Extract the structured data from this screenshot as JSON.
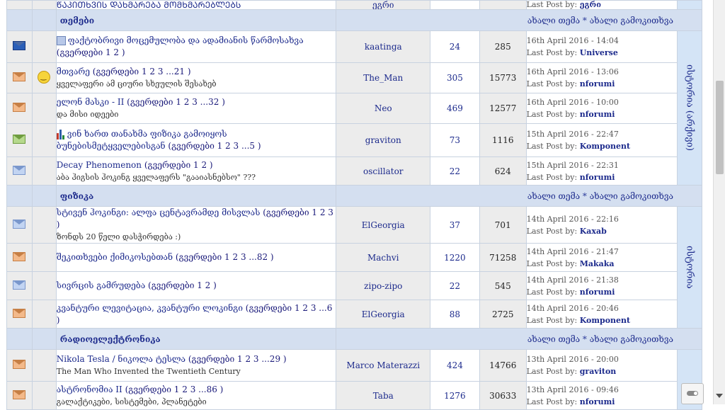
{
  "top_partial": {
    "title": "ᲬᲐᲙᲘᲗᲮᲕᲘᲡ ᲓᲐᲮᲛᲐᲠᲔᲑᲐ ᲛᲝᲛᲮᲛᲐᲠᲔᲑᲚᲔᲑᲡ",
    "author": "ეგრი",
    "last_prefix": "Last Post by:",
    "last_user": "ეგრი"
  },
  "categories": [
    {
      "title": "თემები",
      "new_topic": "ახალი თემა",
      "separator": "*",
      "new_poll": "ახალი გამოკითხვა",
      "side_label": "ისტორია (არქივი)",
      "topics": [
        {
          "icon": "envelope-new",
          "emoticon": "",
          "prefix_icon": "mini",
          "title": "ფაქტობრივი მოცემულობა და ადამიანის წარმოსახვა",
          "pages": "(გვერდები 1 2 )",
          "desc": "",
          "author": "kaatinga",
          "replies": "24",
          "views": "285",
          "last_date": "16th April 2016 - 14:04",
          "last_by": "Last Post by:",
          "last_user": "Universe"
        },
        {
          "icon": "envelope-hot",
          "emoticon": "smiley",
          "prefix_icon": "",
          "title": "მთვარე",
          "pages": "(გვერდები 1 2 3 ...21 )",
          "desc": "ყველაფერი ამ ციური სხეულის შესახებ",
          "author": "The_Man",
          "replies": "305",
          "views": "15773",
          "last_date": "16th April 2016 - 13:06",
          "last_by": "Last Post by:",
          "last_user": "nforumi"
        },
        {
          "icon": "envelope-hot",
          "emoticon": "",
          "prefix_icon": "",
          "title": "ელონ მასკი - II",
          "pages": "(გვერდები 1 2 3 ...32 )",
          "desc": "და მისი იდეები",
          "author": "Neo",
          "replies": "469",
          "views": "12577",
          "last_date": "16th April 2016 - 10:00",
          "last_by": "Last Post by:",
          "last_user": "nforumi"
        },
        {
          "icon": "envelope-green",
          "emoticon": "",
          "prefix_icon": "chart",
          "title": "ვინ ხართ თანახმა ფიზიკა გამოიყოს ბუნებისმეტყველებისგან",
          "pages": "(გვერდები 1 2 3 ...5 )",
          "desc": "",
          "author": "graviton",
          "replies": "73",
          "views": "1116",
          "last_date": "15th April 2016 - 22:47",
          "last_by": "Last Post by:",
          "last_user": "Komponent"
        },
        {
          "icon": "envelope-lite",
          "emoticon": "",
          "prefix_icon": "",
          "title": "Decay Phenomenon",
          "pages": "(გვერდები 1 2 )",
          "desc": "აბა ჰიგსის ჰოკინგ ყველაფერს \"გააიასნებსო\" ???",
          "author": "oscillator",
          "replies": "22",
          "views": "624",
          "last_date": "15th April 2016 - 22:31",
          "last_by": "Last Post by:",
          "last_user": "nforumi"
        }
      ]
    },
    {
      "title": "ფიზიკა",
      "new_topic": "ახალი თემა",
      "separator": "*",
      "new_poll": "ახალი გამოკითხვა",
      "side_label": "ისტორია",
      "topics": [
        {
          "icon": "envelope-lite",
          "emoticon": "",
          "prefix_icon": "",
          "title": "სტივენ ჰოკინგი: ალფა ცენტავრამდე მისვლას",
          "pages": "(გვერდები 1 2 3 )",
          "desc": "ზონდს 20 წელი დასჭირდება :)",
          "author": "ElGeorgia",
          "replies": "37",
          "views": "701",
          "last_date": "14th April 2016 - 22:16",
          "last_by": "Last Post by:",
          "last_user": "Kaxab"
        },
        {
          "icon": "envelope-hot",
          "emoticon": "",
          "prefix_icon": "",
          "title": "შეკითხვები ქიმიკოსებთან",
          "pages": "(გვერდები 1 2 3 ...82 )",
          "desc": "",
          "author": "Machvi",
          "replies": "1220",
          "views": "71258",
          "last_date": "14th April 2016 - 21:47",
          "last_by": "Last Post by:",
          "last_user": "Makaka"
        },
        {
          "icon": "envelope-lite",
          "emoticon": "",
          "prefix_icon": "",
          "title": "სივრცის გამრუდება",
          "pages": "(გვერდები 1 2 )",
          "desc": "",
          "author": "zipo-zipo",
          "replies": "22",
          "views": "545",
          "last_date": "14th April 2016 - 21:38",
          "last_by": "Last Post by:",
          "last_user": "nforumi"
        },
        {
          "icon": "envelope-hot",
          "emoticon": "",
          "prefix_icon": "",
          "title": "კვანტური ლევიტაცია, კვანტური ლოკინგი",
          "pages": "(გვერდები 1 2 3 ...6 )",
          "desc": "",
          "author": "ElGeorgia",
          "replies": "88",
          "views": "2725",
          "last_date": "14th April 2016 - 20:46",
          "last_by": "Last Post by:",
          "last_user": "Komponent"
        }
      ]
    },
    {
      "title": "რადიოელექტრონიკა",
      "new_topic": "ახალი თემა",
      "separator": "*",
      "new_poll": "ახალი გამოკითხვა",
      "side_label": "",
      "topics": [
        {
          "icon": "envelope-hot",
          "emoticon": "",
          "prefix_icon": "",
          "title": "Nikola Tesla / ნიკოლა ტესლა",
          "pages": "(გვერდები 1 2 3 ...29 )",
          "desc": "The Man Who Invented the Twentieth Century",
          "author": "Marco Materazzi",
          "replies": "424",
          "views": "14766",
          "last_date": "13th April 2016 - 20:00",
          "last_by": "Last Post by:",
          "last_user": "graviton"
        },
        {
          "icon": "envelope-hot",
          "emoticon": "",
          "prefix_icon": "",
          "title": "ასტრონომია II",
          "pages": "(გვერდები 1 2 3 ...86 )",
          "desc": "გალაქტიკები, სისტემები, პლანეტები",
          "author": "Taba",
          "replies": "1276",
          "views": "30633",
          "last_date": "13th April 2016 - 09:46",
          "last_by": "Last Post by:",
          "last_user": "nforumi"
        }
      ]
    }
  ]
}
